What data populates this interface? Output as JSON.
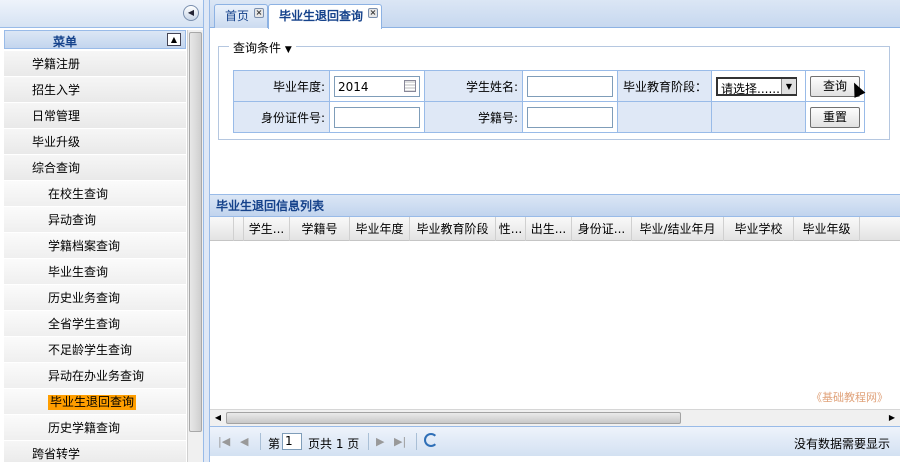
{
  "sidebar": {
    "menu_title": "菜单",
    "items": [
      {
        "label": "学籍注册",
        "level": 1
      },
      {
        "label": "招生入学",
        "level": 1
      },
      {
        "label": "日常管理",
        "level": 1
      },
      {
        "label": "毕业升级",
        "level": 1
      },
      {
        "label": "综合查询",
        "level": 1
      },
      {
        "label": "在校生查询",
        "level": 2
      },
      {
        "label": "异动查询",
        "level": 2
      },
      {
        "label": "学籍档案查询",
        "level": 2
      },
      {
        "label": "毕业生查询",
        "level": 2
      },
      {
        "label": "历史业务查询",
        "level": 2
      },
      {
        "label": "全省学生查询",
        "level": 2
      },
      {
        "label": "不足龄学生查询",
        "level": 2
      },
      {
        "label": "异动在办业务查询",
        "level": 2
      },
      {
        "label": "毕业生退回查询",
        "level": 2,
        "selected": true
      },
      {
        "label": "历史学籍查询",
        "level": 2
      },
      {
        "label": "跨省转学",
        "level": 1
      }
    ]
  },
  "tabs": [
    {
      "label": "首页",
      "active": false
    },
    {
      "label": "毕业生退回查询",
      "active": true
    }
  ],
  "query": {
    "legend": "查询条件",
    "grad_year_label": "毕业年度:",
    "grad_year_value": "2014",
    "student_name_label": "学生姓名:",
    "student_name_value": "",
    "edu_stage_label": "毕业教育阶段：",
    "edu_stage_value": "请选择......",
    "id_card_label": "身份证件号:",
    "id_card_value": "",
    "student_no_label": "学籍号:",
    "student_no_value": "",
    "search_button": "查询",
    "reset_button": "重置"
  },
  "grid": {
    "title": "毕业生退回信息列表",
    "columns": [
      "学生...",
      "学籍号",
      "毕业年度",
      "毕业教育阶段",
      "性...",
      "出生...",
      "身份证...",
      "毕业/结业年月",
      "毕业学校",
      "毕业年级"
    ]
  },
  "pager": {
    "page_prefix": "第",
    "page_value": "1",
    "page_suffix": "页共 1 页",
    "status": "没有数据需要显示"
  },
  "watermark": "《基础教程网》",
  "colors": {
    "selected_highlight": "#ff9e00",
    "header_text": "#15428b",
    "border": "#99bbe8"
  }
}
